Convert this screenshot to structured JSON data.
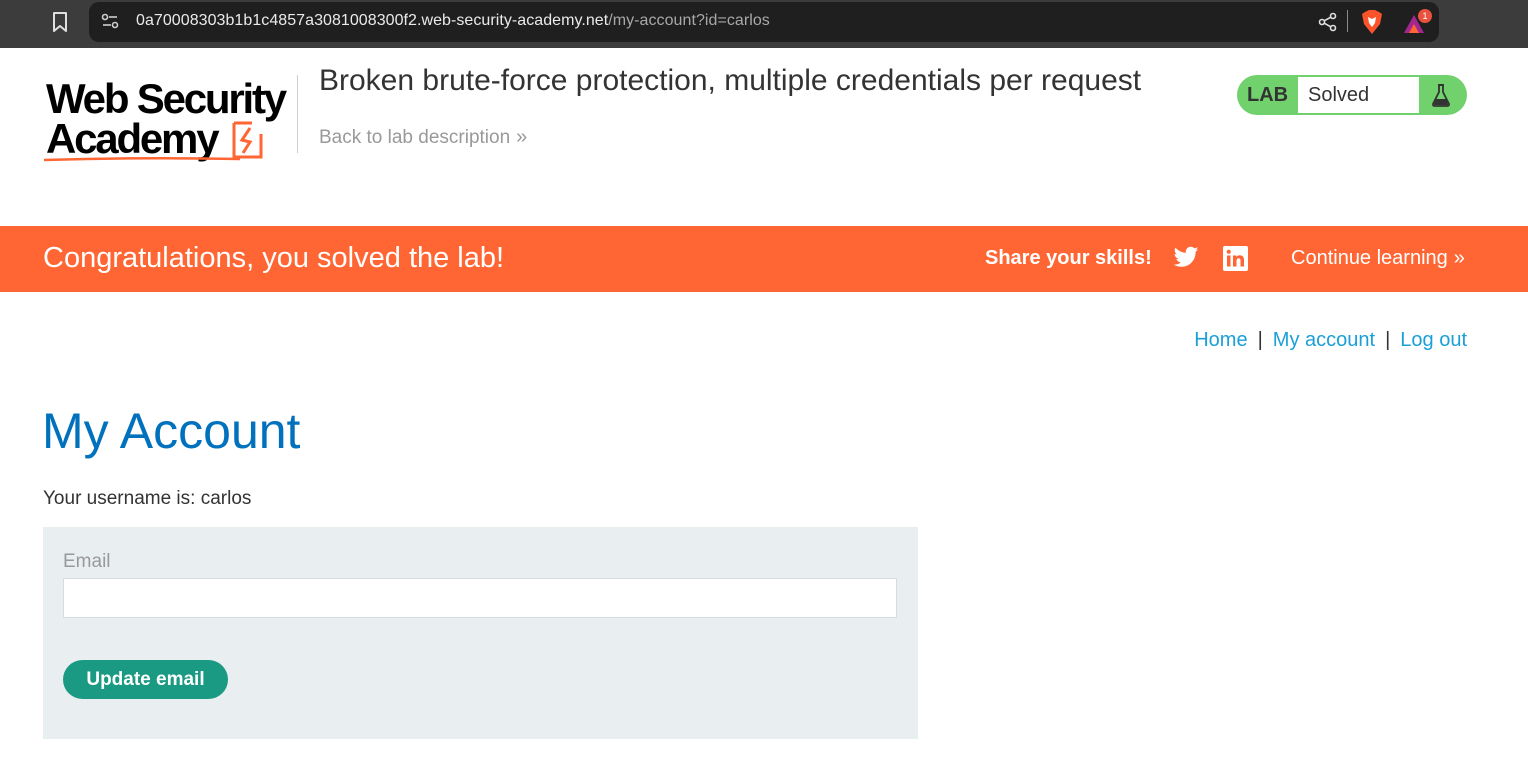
{
  "browser": {
    "url_host": "0a70008303b1b1c4857a3081008300f2.web-security-academy.net",
    "url_path": "/my-account?id=carlos",
    "notification_count": "1",
    "icons": [
      "bookmark-icon",
      "site-info-icon",
      "share-icon",
      "brave-shield-icon",
      "brave-rewards-icon"
    ]
  },
  "header": {
    "logo_line1": "Web Security",
    "logo_line2": "Academy",
    "lab_title": "Broken brute-force protection, multiple credentials per request",
    "back_link": "Back to lab description",
    "back_chevron": "»",
    "lab_tag": "LAB",
    "status": "Solved",
    "colors": {
      "status_green": "#70d16d",
      "brand_orange": "#ff6633"
    }
  },
  "banner": {
    "message": "Congratulations, you solved the lab!",
    "share_label": "Share your skills!",
    "continue_label": "Continue learning",
    "continue_chevron": "»",
    "icons": [
      "twitter-icon",
      "linkedin-icon"
    ]
  },
  "nav": {
    "home": "Home",
    "separator": "|",
    "my_account": "My account",
    "log_out": "Log out",
    "link_color": "#1b9fd9"
  },
  "main": {
    "title": "My Account",
    "username_line": "Your username is: carlos",
    "email_label": "Email",
    "email_value": "",
    "update_button": "Update email",
    "colors": {
      "title_blue": "#0071bc",
      "button_green": "#1a9a82",
      "panel_bg": "#e9eef1"
    }
  }
}
